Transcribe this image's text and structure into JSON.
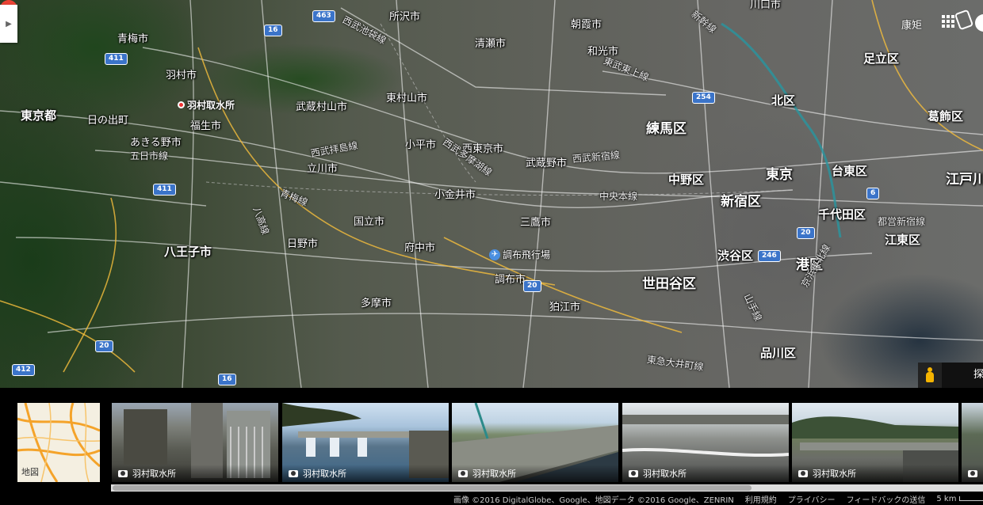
{
  "map": {
    "places": [
      {
        "text": "所沢市",
        "size": "s"
      },
      {
        "text": "青梅市",
        "size": "s"
      },
      {
        "text": "羽村市",
        "size": "s"
      },
      {
        "text": "清瀬市",
        "size": "s"
      },
      {
        "text": "朝霞市",
        "size": "s"
      },
      {
        "text": "川口市",
        "size": "s"
      },
      {
        "text": "和光市",
        "size": "s"
      },
      {
        "text": "足立区",
        "size": "m"
      },
      {
        "text": "東京都",
        "size": "m"
      },
      {
        "text": "武蔵村山市",
        "size": "s"
      },
      {
        "text": "東村山市",
        "size": "s"
      },
      {
        "text": "北区",
        "size": "m"
      },
      {
        "text": "葛飾区",
        "size": "m"
      },
      {
        "text": "日の出町",
        "size": "s"
      },
      {
        "text": "福生市",
        "size": "s"
      },
      {
        "text": "練馬区",
        "size": "l"
      },
      {
        "text": "あきる野市",
        "size": "s"
      },
      {
        "text": "小平市",
        "size": "s"
      },
      {
        "text": "西東京市",
        "size": "s"
      },
      {
        "text": "武蔵野市",
        "size": "s"
      },
      {
        "text": "立川市",
        "size": "s"
      },
      {
        "text": "中野区",
        "size": "m"
      },
      {
        "text": "東京",
        "size": "l"
      },
      {
        "text": "台東区",
        "size": "m"
      },
      {
        "text": "江戸川",
        "size": "l"
      },
      {
        "text": "小金井市",
        "size": "s"
      },
      {
        "text": "新宿区",
        "size": "l"
      },
      {
        "text": "千代田区",
        "size": "m"
      },
      {
        "text": "国立市",
        "size": "s"
      },
      {
        "text": "三鷹市",
        "size": "s"
      },
      {
        "text": "江東区",
        "size": "m"
      },
      {
        "text": "日野市",
        "size": "s"
      },
      {
        "text": "府中市",
        "size": "s"
      },
      {
        "text": "八王子市",
        "size": "m"
      },
      {
        "text": "渋谷区",
        "size": "m"
      },
      {
        "text": "港区",
        "size": "l"
      },
      {
        "text": "調布市",
        "size": "s"
      },
      {
        "text": "世田谷区",
        "size": "l"
      },
      {
        "text": "多摩市",
        "size": "s"
      },
      {
        "text": "狛江市",
        "size": "s"
      },
      {
        "text": "品川区",
        "size": "m"
      }
    ],
    "rail_lines": [
      "西武池袋線",
      "東武東上線",
      "西武拝島線",
      "西武新宿線",
      "中央本線",
      "青梅線",
      "八高線",
      "西武多摩湖線",
      "都営新宿線",
      "五日市線",
      "山手線",
      "東急大井町線",
      "京浜東北線",
      "新幹線"
    ],
    "route_shields": [
      "463",
      "16",
      "411",
      "254",
      "411",
      "20",
      "246",
      "20",
      "6",
      "20",
      "20",
      "16",
      "412"
    ],
    "pin": {
      "label": "羽村取水所",
      "color": "#ea4335"
    },
    "airport": {
      "label": "調布飛行場"
    },
    "header": {
      "signin": "康矩"
    },
    "explore_label": "探"
  },
  "strip": {
    "map_thumb_label": "地図",
    "photos": [
      {
        "caption": "羽村取水所"
      },
      {
        "caption": "羽村取水所"
      },
      {
        "caption": "羽村取水所"
      },
      {
        "caption": "羽村取水所"
      },
      {
        "caption": "羽村取水所"
      },
      {
        "caption": ""
      }
    ],
    "footer": {
      "imagery": "画像 ©2016 DigitalGlobe、Google、地図データ ©2016 Google、ZENRIN",
      "terms": "利用規約",
      "privacy": "プライバシー",
      "feedback": "フィードバックの送信",
      "scale": "5 km"
    }
  },
  "colors": {
    "shield": "#3b74c9",
    "pin": "#ea4335",
    "pegman": "#f5b400"
  }
}
